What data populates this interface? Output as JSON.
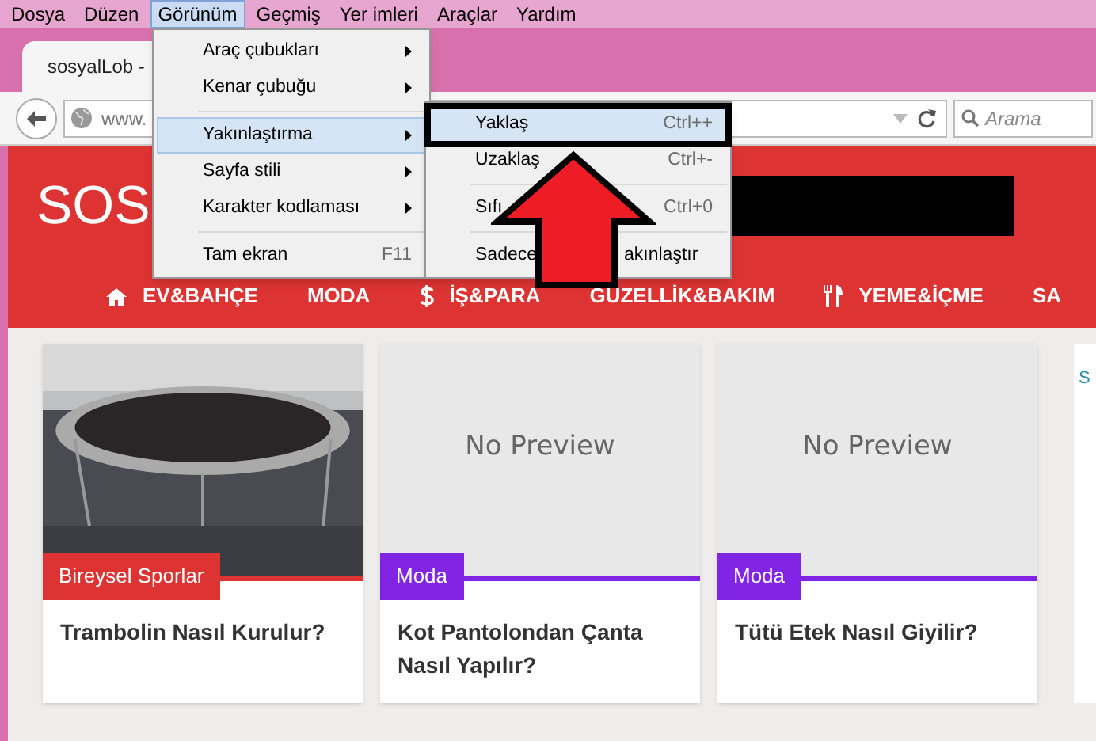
{
  "menubar": [
    {
      "label": "Dosya",
      "selected": false
    },
    {
      "label": "Düzen",
      "selected": false
    },
    {
      "label": "Görünüm",
      "selected": true
    },
    {
      "label": "Geçmiş",
      "selected": false
    },
    {
      "label": "Yer imleri",
      "selected": false
    },
    {
      "label": "Araçlar",
      "selected": false
    },
    {
      "label": "Yardım",
      "selected": false
    }
  ],
  "tab": {
    "title": "sosyalLob -"
  },
  "address_bar": {
    "url": "www.",
    "search_placeholder": "Arama"
  },
  "menu": [
    {
      "kind": "submenu",
      "label": "Araç çubukları",
      "selected": false
    },
    {
      "kind": "submenu",
      "label": "Kenar çubuğu",
      "selected": false
    },
    {
      "kind": "separator"
    },
    {
      "kind": "submenu",
      "label": "Yakınlaştırma",
      "selected": true
    },
    {
      "kind": "submenu",
      "label": "Sayfa stili",
      "selected": false
    },
    {
      "kind": "submenu",
      "label": "Karakter kodlaması",
      "selected": false
    },
    {
      "kind": "separator"
    },
    {
      "kind": "item",
      "label": "Tam ekran",
      "shortcut": "F11",
      "selected": false
    }
  ],
  "submenu": [
    {
      "kind": "item",
      "label": "Yaklaş",
      "shortcut": "Ctrl++",
      "selected": true
    },
    {
      "kind": "item",
      "label": "Uzaklaş",
      "shortcut": "Ctrl+-",
      "selected": false
    },
    {
      "kind": "separator"
    },
    {
      "kind": "item",
      "label": "Sıfı",
      "shortcut": "Ctrl+0",
      "selected": false
    },
    {
      "kind": "separator"
    },
    {
      "kind": "split",
      "label": "Sadece",
      "label_end": "akınlaştır",
      "selected": false
    }
  ],
  "site": {
    "logo": "SOS",
    "nav": [
      {
        "kind": "home",
        "label": "EV&BAHÇE"
      },
      {
        "kind": "plain",
        "label": "MODA"
      },
      {
        "kind": "dollar",
        "label": "İŞ&PARA"
      },
      {
        "kind": "plain",
        "label": "GÜZELLİK&BAKIM"
      },
      {
        "kind": "cutlery",
        "label": "YEME&İÇME"
      },
      {
        "kind": "plain",
        "label": "SA"
      }
    ],
    "cards": [
      {
        "kind": "picture",
        "category": "Bireysel Sporlar",
        "color": "#dd3333",
        "title": "Trambolin Nasıl Kurulur?"
      },
      {
        "kind": "no_preview",
        "preview_text": "No Preview",
        "category": "Moda",
        "color": "#8224e3",
        "title": "Kot Pantolondan Çanta Nasıl Yapılır?"
      },
      {
        "kind": "no_preview",
        "preview_text": "No Preview",
        "category": "Moda",
        "color": "#8224e3",
        "title": "Tütü Etek Nasıl Giyilir?"
      }
    ],
    "sidebar_text": "S"
  }
}
